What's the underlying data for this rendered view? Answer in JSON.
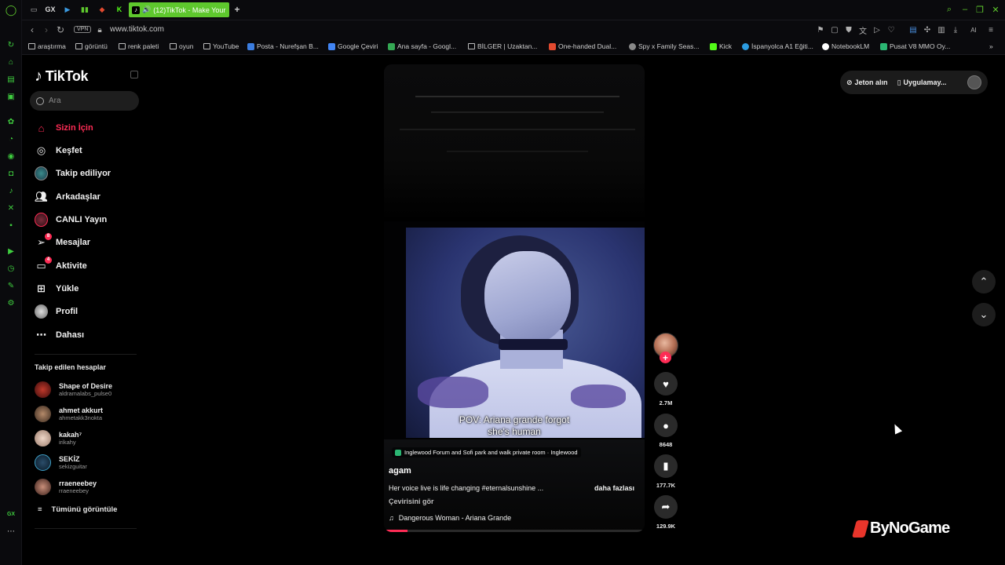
{
  "browser": {
    "active_tab_title": "(12)TikTok - Make Your",
    "tab_shortcut_gx": "GX",
    "url": "www.tiktok.com",
    "vpn_label": "VPN",
    "ai_label": "AI",
    "bookmarks": [
      {
        "label": "araştırma",
        "type": "folder"
      },
      {
        "label": "görüntü",
        "type": "folder"
      },
      {
        "label": "renk paleti",
        "type": "folder"
      },
      {
        "label": "oyun",
        "type": "folder"
      },
      {
        "label": "YouTube",
        "type": "page"
      },
      {
        "label": "Posta - Nurefşan B...",
        "type": "site",
        "color": "#3b7de0"
      },
      {
        "label": "Google Çeviri",
        "type": "site",
        "color": "#4285f4"
      },
      {
        "label": "Ana sayfa - Googl...",
        "type": "site",
        "color": "#34a853"
      },
      {
        "label": "BİLGER | Uzaktan...",
        "type": "page"
      },
      {
        "label": "One-handed Dual...",
        "type": "site",
        "color": "#e34a2f"
      },
      {
        "label": "Spy x Family Seas...",
        "type": "site",
        "color": "#888888"
      },
      {
        "label": "Kick",
        "type": "site",
        "color": "#53fc18"
      },
      {
        "label": "İspanyolca A1 Eğiti...",
        "type": "site",
        "color": "#2b9be0"
      },
      {
        "label": "NotebookLM",
        "type": "site",
        "color": "#ffffff"
      },
      {
        "label": "Pusat V8 MMO Oy...",
        "type": "site",
        "color": "#2bb673"
      }
    ],
    "gx_bottom_label": "GX"
  },
  "sidebar": {
    "logo": "TikTok",
    "search_placeholder": "Ara",
    "nav": [
      {
        "label": "Sizin İçin",
        "icon": "home-icon",
        "active": true
      },
      {
        "label": "Keşfet",
        "icon": "compass-icon"
      },
      {
        "label": "Takip ediliyor",
        "icon": "following-avatar-icon"
      },
      {
        "label": "Arkadaşlar",
        "icon": "friends-icon"
      },
      {
        "label": "CANLI Yayın",
        "icon": "live-icon"
      },
      {
        "label": "Mesajlar",
        "icon": "messages-icon",
        "badge": "8"
      },
      {
        "label": "Aktivite",
        "icon": "activity-icon",
        "badge": "4"
      },
      {
        "label": "Yükle",
        "icon": "upload-icon"
      },
      {
        "label": "Profil",
        "icon": "profile-avatar-icon"
      },
      {
        "label": "Dahası",
        "icon": "more-icon"
      }
    ],
    "following_title": "Takip edilen hesaplar",
    "following": [
      {
        "name": "Shape of Desire",
        "user": "aldramalabs_pulse0"
      },
      {
        "name": "ahmet akkurt",
        "user": "ahmetakk3nokta"
      },
      {
        "name": "kakah⁷",
        "user": "irikahy"
      },
      {
        "name": "SEKİZ",
        "user": "sekizguitar"
      },
      {
        "name": "rraeneebey",
        "user": "rraeneebey"
      }
    ],
    "see_all": "Tümünü görüntüle"
  },
  "video": {
    "caption_line1": "POV: Ariana grande forgot",
    "caption_line2": "she's human",
    "location": "Inglewood Forum and Sofi park and walk private room · Inglewood",
    "author": "agam",
    "description": "Her voice live is life changing #eternalsunshine ...",
    "more": "daha fazlası",
    "translate": "Çevirisini gör",
    "music": "Dangerous Woman - Ariana Grande",
    "progress_fraction": 0.09
  },
  "actions": {
    "likes": "2.7M",
    "comments": "8648",
    "saves": "177.7K",
    "shares": "129.9K"
  },
  "topbar": {
    "coins": "Jeton alın",
    "app": "Uygulamay..."
  },
  "watermark": "ByNoGame"
}
